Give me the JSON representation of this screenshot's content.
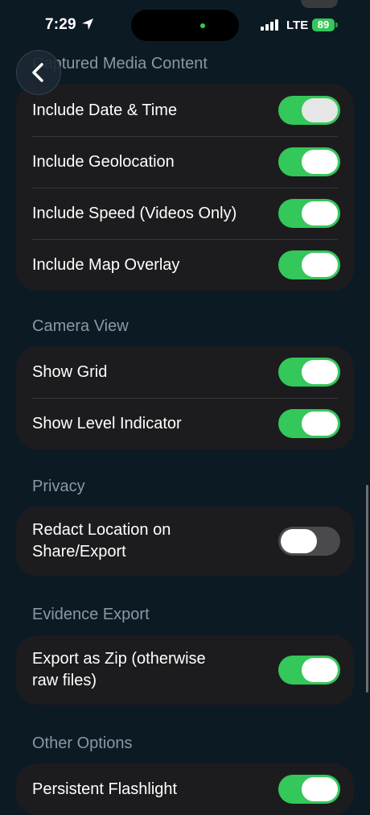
{
  "status_bar": {
    "time": "7:29",
    "network": "LTE",
    "battery": "89"
  },
  "sections": [
    {
      "header": "Captured Media Content",
      "rows": [
        {
          "label": "Include Date & Time",
          "on": true
        },
        {
          "label": "Include Geolocation",
          "on": true
        },
        {
          "label": "Include Speed (Videos Only)",
          "on": true
        },
        {
          "label": "Include Map Overlay",
          "on": true
        }
      ]
    },
    {
      "header": "Camera View",
      "rows": [
        {
          "label": "Show Grid",
          "on": true
        },
        {
          "label": "Show Level Indicator",
          "on": true
        }
      ]
    },
    {
      "header": "Privacy",
      "rows": [
        {
          "label": "Redact Location on Share/Export",
          "on": false
        }
      ]
    },
    {
      "header": "Evidence Export",
      "rows": [
        {
          "label": "Export as Zip (otherwise raw files)",
          "on": true
        }
      ]
    },
    {
      "header": "Other Options",
      "rows": [
        {
          "label": "Persistent Flashlight",
          "on": true
        }
      ]
    }
  ],
  "colors": {
    "toggle_on": "#34c759",
    "toggle_off": "#4a4a4c",
    "background": "#0c1a24",
    "group": "#1c1c1e"
  }
}
